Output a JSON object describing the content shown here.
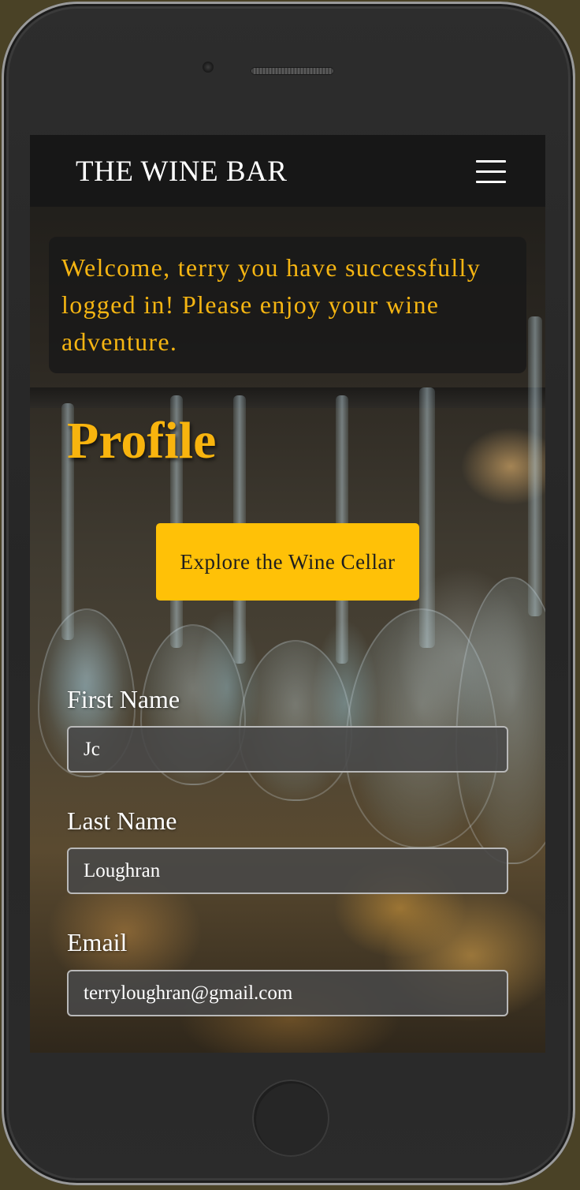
{
  "navbar": {
    "brand": "THE WINE BAR",
    "menu_icon": "hamburger-menu-icon"
  },
  "alert": {
    "message": "Welcome, terry you have successfully logged in! Please enjoy your wine adventure."
  },
  "page": {
    "title": "Profile"
  },
  "cta": {
    "label": "Explore the Wine Cellar"
  },
  "form": {
    "first_name": {
      "label": "First Name",
      "value": "Jc"
    },
    "last_name": {
      "label": "Last Name",
      "value": "Loughran"
    },
    "email": {
      "label": "Email",
      "value": "terryloughran@gmail.com"
    }
  },
  "colors": {
    "accent": "#ffc107",
    "alert_text": "#f5b512",
    "navbar_bg": "#171717"
  }
}
